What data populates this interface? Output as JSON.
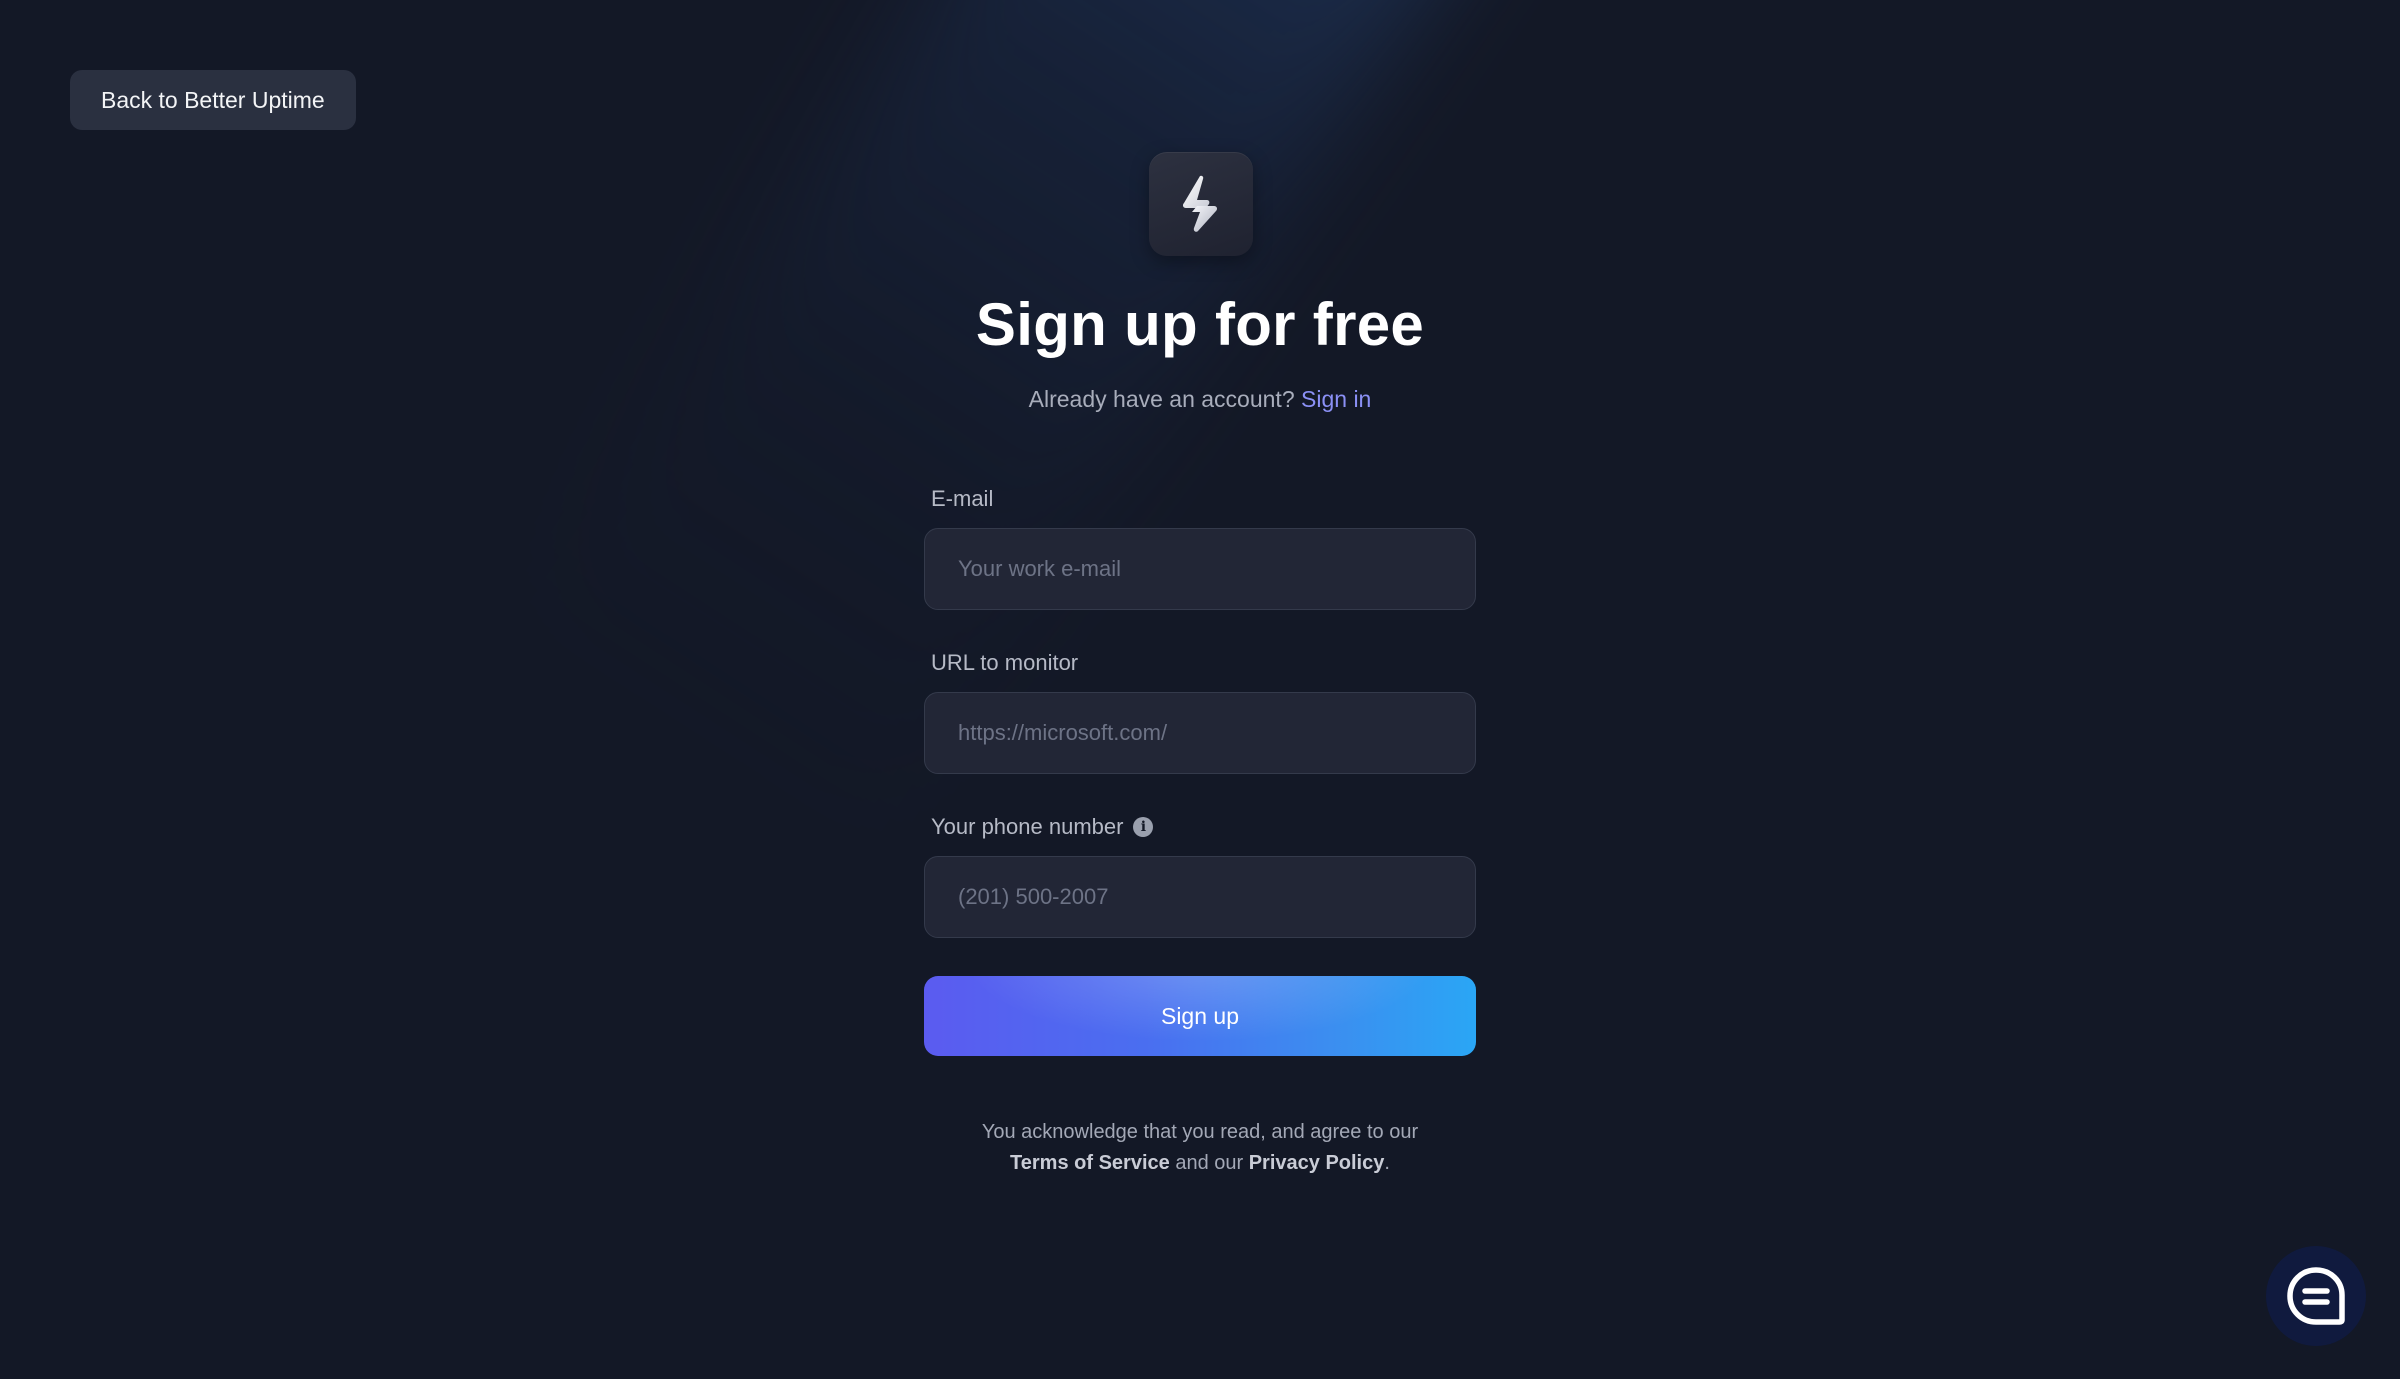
{
  "header": {
    "back_label": "Back to Better Uptime"
  },
  "logo": {
    "icon": "lightning-bolt-icon"
  },
  "hero": {
    "title": "Sign up for free",
    "have_account": "Already have an account? ",
    "sign_in": "Sign in"
  },
  "form": {
    "email": {
      "label": "E-mail",
      "placeholder": "Your work e-mail",
      "value": ""
    },
    "url": {
      "label": "URL to monitor",
      "placeholder": "https://microsoft.com/",
      "value": ""
    },
    "phone": {
      "label": "Your phone number",
      "info_icon": "info-icon",
      "placeholder": "(201) 500-2007",
      "value": ""
    },
    "submit_label": "Sign up"
  },
  "legal": {
    "line1": "You acknowledge that you read, and agree to our",
    "terms": "Terms of Service",
    "and_our": " and our ",
    "privacy": "Privacy Policy",
    "period": "."
  },
  "chat": {
    "icon": "chat-bubble-icon"
  },
  "colors": {
    "background": "#131826",
    "accent_link": "#8b90f5",
    "button_gradient_start": "#5b5bf0",
    "button_gradient_end": "#2aa6f5"
  }
}
